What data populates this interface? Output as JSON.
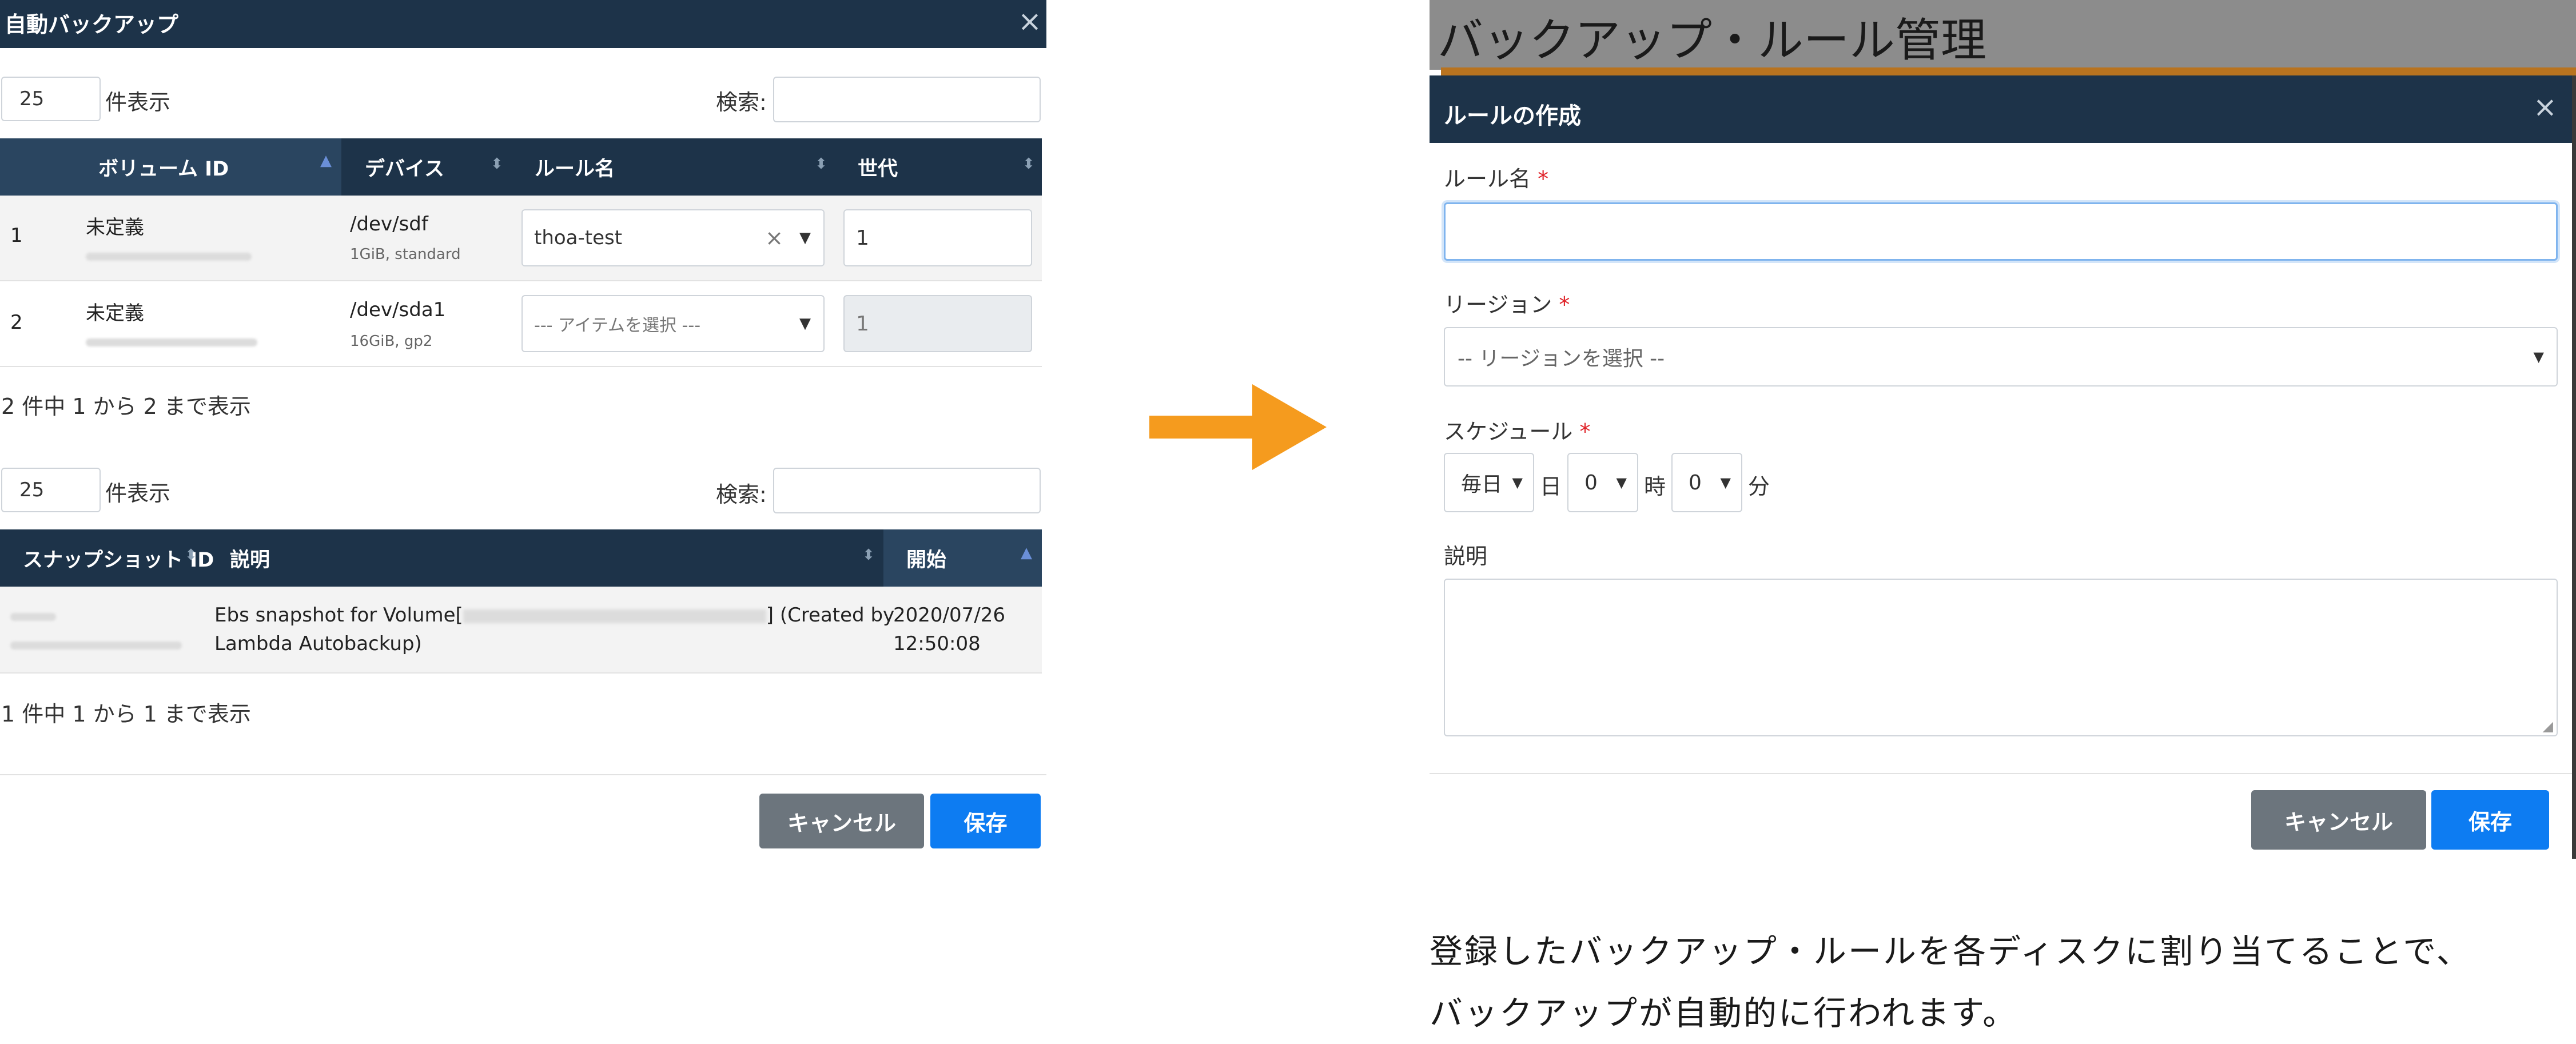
{
  "left": {
    "title": "自動バックアップ",
    "close": "×",
    "volumes": {
      "length": "25",
      "length_suffix": "件表示",
      "search_label": "検索:",
      "headers": [
        "ボリューム ID",
        "デバイス",
        "ルール名",
        "世代"
      ],
      "rows": [
        {
          "index": "1",
          "volume": "未定義",
          "device": "/dev/sdf",
          "device_sub": "1GiB, standard",
          "rule": "thoa-test",
          "generation": "1"
        },
        {
          "index": "2",
          "volume": "未定義",
          "device": "/dev/sda1",
          "device_sub": "16GiB, gp2",
          "rule": "--- アイテムを選択 ---",
          "generation": "1"
        }
      ],
      "info": "2 件中 1 から 2 まで表示"
    },
    "snapshots": {
      "length": "25",
      "length_suffix": "件表示",
      "search_label": "検索:",
      "headers": [
        "スナップショット ID",
        "説明",
        "開始"
      ],
      "rows": [
        {
          "desc_1": "Ebs snapshot for Volume[",
          "desc_2": "] (Created by",
          "desc_3": "Lambda Autobackup)",
          "start_1": "2020/07/26",
          "start_2": "12:50:08"
        }
      ],
      "info": "1 件中 1 から 1 まで表示"
    },
    "cancel": "キャンセル",
    "save": "保存"
  },
  "right": {
    "page_title": "バックアップ・ルール管理",
    "dialog_title": "ルールの作成",
    "close": "×",
    "rule_name_label": "ルール名",
    "region_label": "リージョン",
    "region_placeholder": "-- リージョンを選択 --",
    "schedule_label": "スケジュール",
    "schedule_freq": "毎日",
    "day_suffix": "日",
    "hour_value": "0",
    "hour_suffix": "時",
    "minute_value": "0",
    "minute_suffix": "分",
    "description_label": "説明",
    "required_mark": "*",
    "cancel": "キャンセル",
    "save": "保存"
  },
  "caption": {
    "line1": "登録したバックアップ・ルールを各ディスクに割り当てることで、",
    "line2": "バックアップが自動的に行われます。"
  },
  "colors": {
    "header": "#1d3349",
    "primary": "#0d7cf2",
    "secondary": "#6c757d",
    "arrow": "#f59b1e",
    "required": "#e0242a"
  }
}
